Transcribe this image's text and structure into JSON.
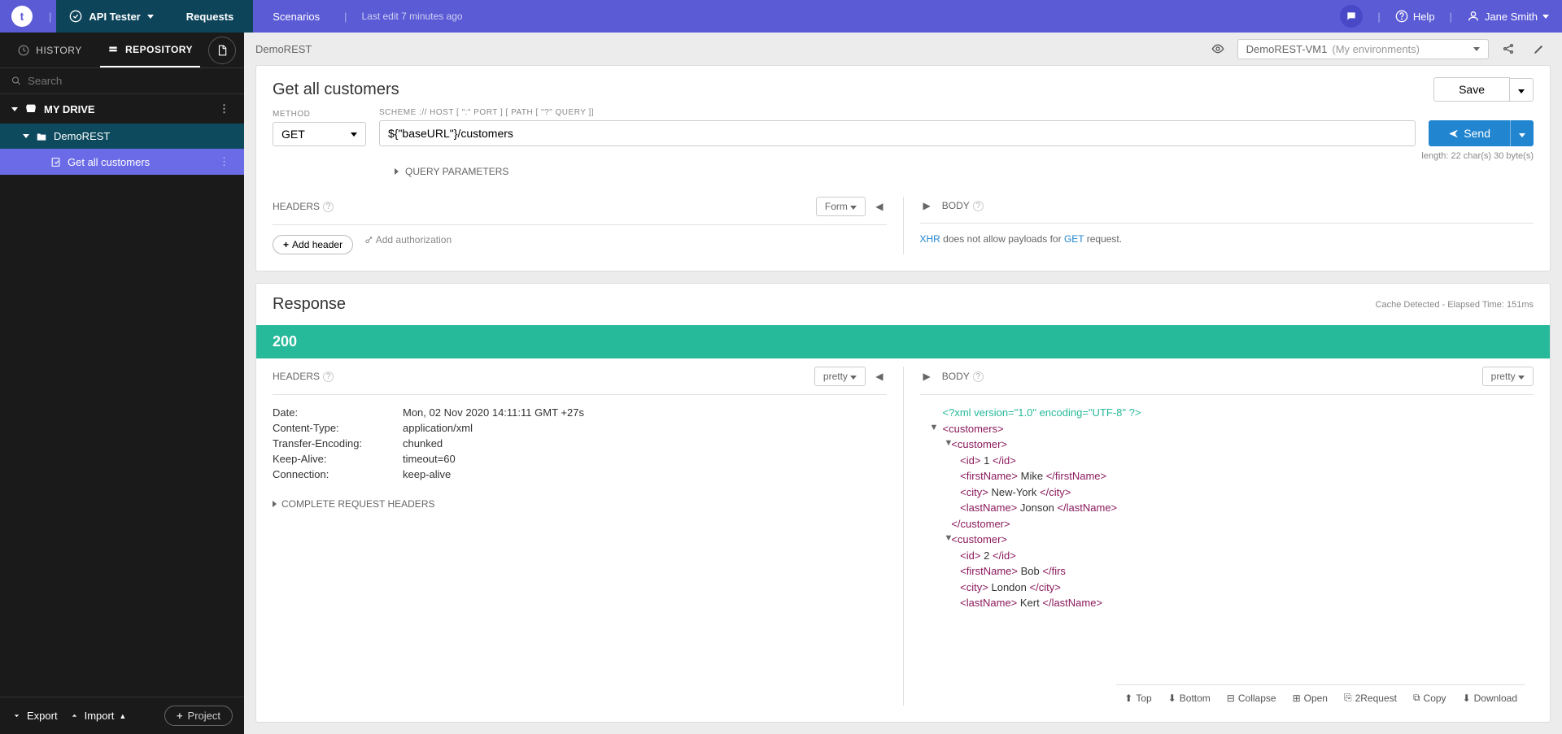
{
  "top": {
    "apiTester": "API Tester",
    "tab1": "Requests",
    "tab2": "Scenarios",
    "lastEdit": "Last edit 7 minutes ago",
    "help": "Help",
    "user": "Jane Smith"
  },
  "sidebar": {
    "historyTab": "HISTORY",
    "repoTab": "REPOSITORY",
    "searchPlaceholder": "Search",
    "myDrive": "MY DRIVE",
    "projectName": "DemoREST",
    "itemName": "Get all customers",
    "exportBtn": "Export",
    "importBtn": "Import",
    "projectBtn": "Project"
  },
  "breadcrumb": "DemoREST",
  "env": {
    "name": "DemoREST-VM1",
    "group": "(My environments)"
  },
  "request": {
    "title": "Get all customers",
    "saveBtn": "Save",
    "methodLabel": "METHOD",
    "method": "GET",
    "schemeLabel": "SCHEME :// HOST [ \":\" PORT ] [ PATH [ \"?\" QUERY ]]",
    "url": "${\"baseURL\"}/customers",
    "sendBtn": "Send",
    "urlMeta": "length: 22 char(s) 30 byte(s)",
    "queryParams": "QUERY PARAMETERS",
    "headersLabel": "HEADERS",
    "formDd": "Form",
    "addHeader": "Add header",
    "addAuth": "Add authorization",
    "bodyLabel": "BODY",
    "bodyMsgPre": "XHR",
    "bodyMsgMid": " does not allow payloads for ",
    "bodyMsgMethod": "GET",
    "bodyMsgPost": " request."
  },
  "response": {
    "title": "Response",
    "meta": "Cache Detected - Elapsed Time: 151ms",
    "status": "200",
    "headersLabel": "HEADERS",
    "prettyDd": "pretty",
    "bodyLabel": "BODY",
    "bodyDd": "pretty",
    "headers": [
      {
        "key": "Date:",
        "val": "Mon, 02 Nov 2020 14:11:11 GMT +27s"
      },
      {
        "key": "Content-Type:",
        "val": "application/xml"
      },
      {
        "key": "Transfer-Encoding:",
        "val": "chunked"
      },
      {
        "key": "Keep-Alive:",
        "val": "timeout=60"
      },
      {
        "key": "Connection:",
        "val": "keep-alive"
      }
    ],
    "completeReq": "COMPLETE REQUEST HEADERS",
    "xmlDecl": "<?xml version=\"1.0\" encoding=\"UTF-8\" ?>",
    "toolbar": {
      "top": "Top",
      "bottom": "Bottom",
      "collapse": "Collapse",
      "open": "Open",
      "toRequest": "2Request",
      "copy": "Copy",
      "download": "Download"
    },
    "body": {
      "customers": [
        {
          "id": "1",
          "firstName": "Mike",
          "city": "New-York",
          "lastName": "Jonson"
        },
        {
          "id": "2",
          "firstName": "Bob",
          "city": "London",
          "lastName": "Kert"
        }
      ]
    }
  }
}
